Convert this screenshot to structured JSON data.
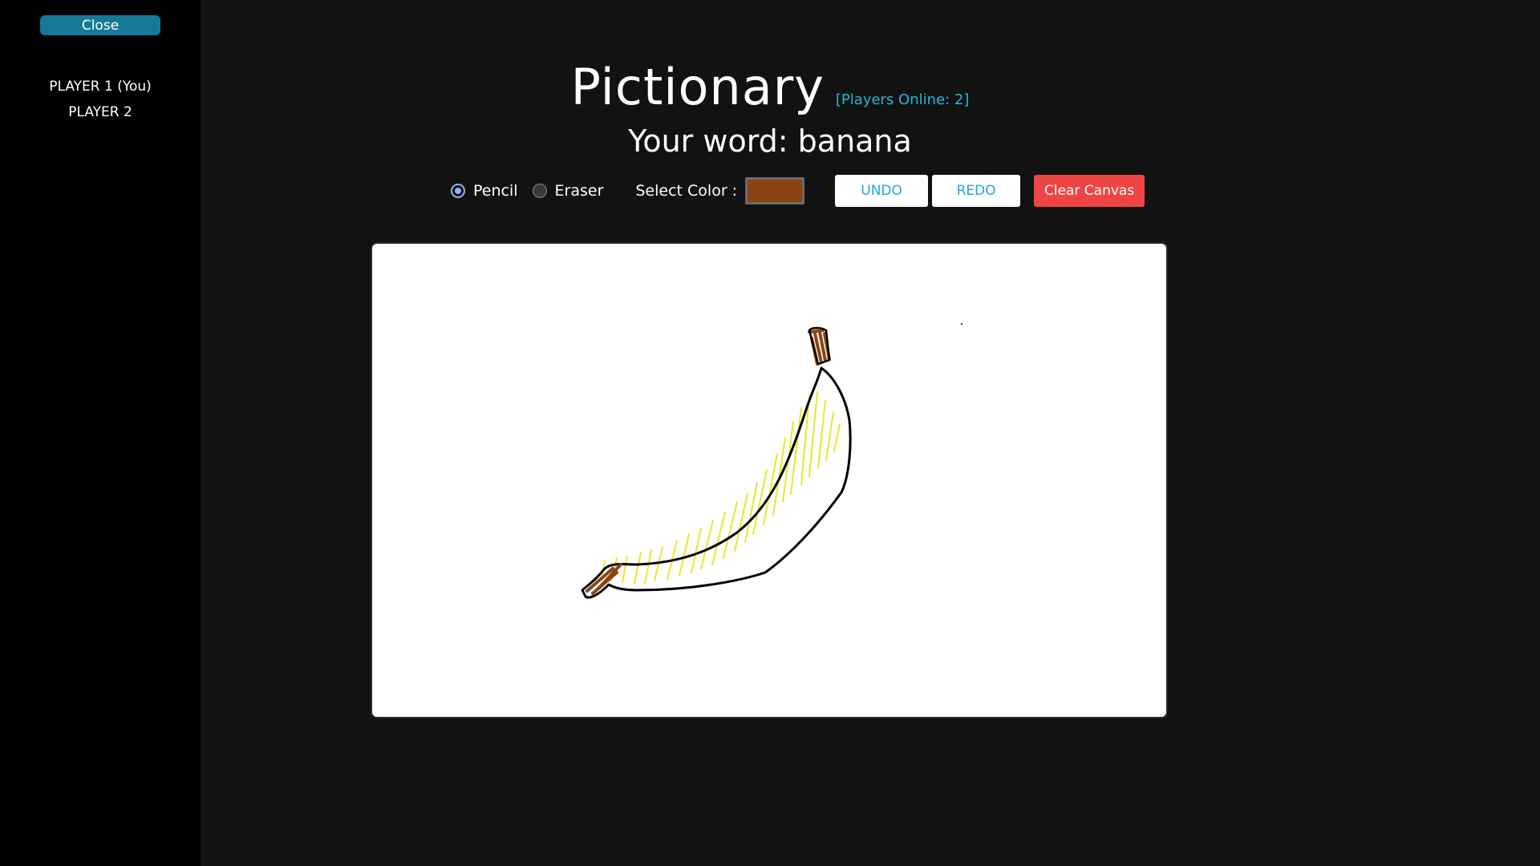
{
  "sidebar": {
    "close_label": "Close",
    "players": [
      "PLAYER 1 (You)",
      "PLAYER 2"
    ]
  },
  "header": {
    "title": "Pictionary",
    "players_online": "[Players Online: 2]",
    "word_line": "Your word: banana"
  },
  "toolbar": {
    "tools": [
      {
        "label": "Pencil",
        "checked": true
      },
      {
        "label": "Eraser",
        "checked": false
      }
    ],
    "color_label": "Select Color :",
    "selected_color": "#8b4513",
    "undo_label": "UNDO",
    "redo_label": "REDO",
    "clear_label": "Clear Canvas"
  },
  "canvas": {
    "drawing": "banana",
    "stroke_colors": {
      "outline": "#000000",
      "fill": "#e8e82a",
      "stem": "#8b4513"
    }
  },
  "colors": {
    "accent": "#157a97",
    "online": "#29b6d9",
    "danger": "#ef4444",
    "background": "#121212",
    "sidebar": "#000000"
  }
}
